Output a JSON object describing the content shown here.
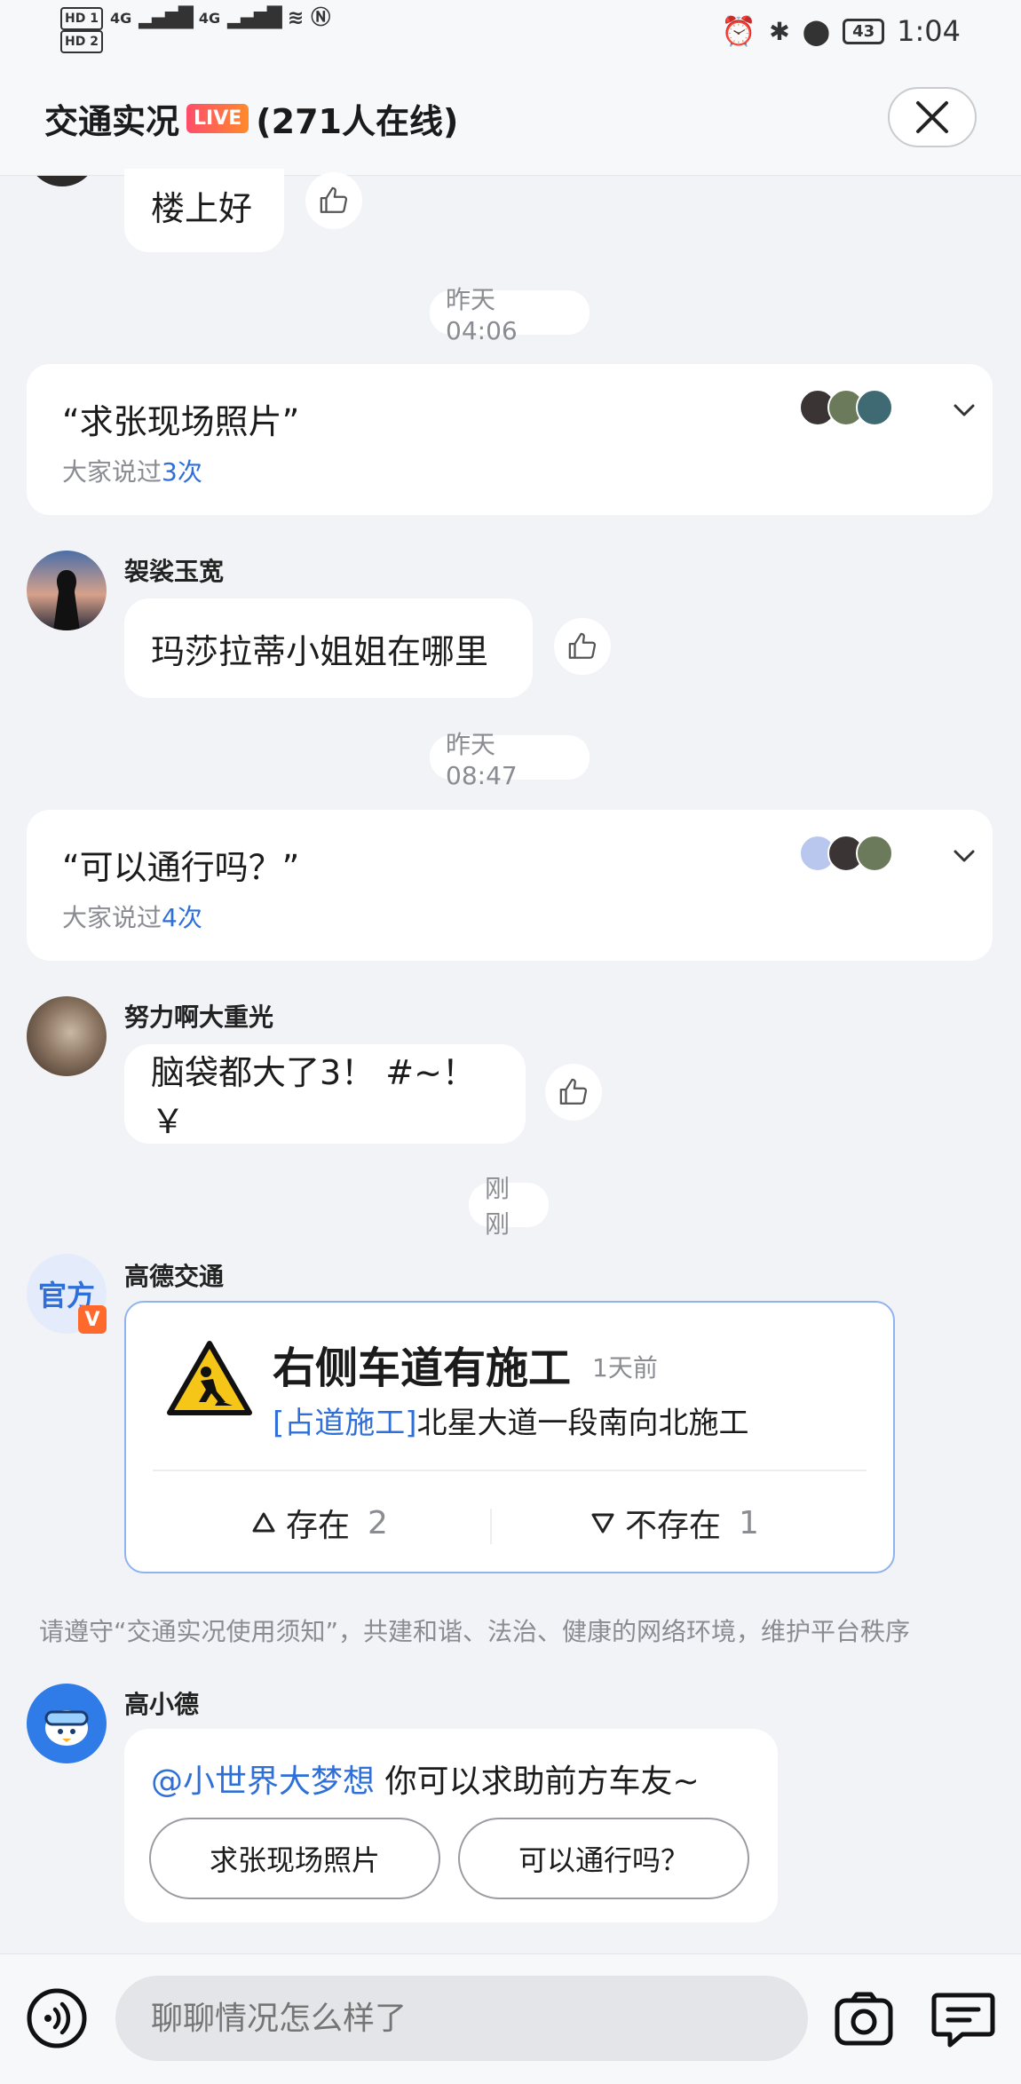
{
  "status_bar": {
    "hd1": "HD 1",
    "hd2": "HD 2",
    "net1": "4G",
    "net2": "4G",
    "battery": "43",
    "time": "1:04"
  },
  "header": {
    "title": "交通实况",
    "live_badge": "LIVE",
    "online": "(271人在线)"
  },
  "messages": {
    "top_bubble": "楼上好",
    "time1": "昨天 04:06",
    "card1": {
      "quote": "“求张现场照片”",
      "sub_prefix": "大家说过",
      "count": "3次"
    },
    "msg1": {
      "user": "袈裟玉宽",
      "text": "玛莎拉蒂小姐姐在哪里"
    },
    "time2": "昨天 08:47",
    "card2": {
      "quote": "“可以通行吗？”",
      "sub_prefix": "大家说过",
      "count": "4次"
    },
    "msg2": {
      "user": "努力啊大重光",
      "text": "脑袋都大了3！ #~！ ￥"
    },
    "time3": "刚刚",
    "official": {
      "user": "高德交通",
      "badge": "官方",
      "v_badge": "V",
      "title": "右侧车道有施工",
      "ago": "1天前",
      "tag": "[占道施工]",
      "desc": "北星大道一段南向北施工",
      "exists_label": "存在",
      "exists_count": "2",
      "not_exists_label": "不存在",
      "not_exists_count": "1"
    },
    "notice": "请遵守“交通实况使用须知”，共建和谐、法治、健康的网络环境，维护平台秩序",
    "bot": {
      "user": "高小德",
      "mention": "@小世界大梦想",
      "text": " 你可以求助前方车友~",
      "btn1": "求张现场照片",
      "btn2": "可以通行吗？"
    }
  },
  "input": {
    "placeholder": "聊聊情况怎么样了"
  },
  "colors": {
    "accent": "#2f6fd9",
    "background": "#f2f3f7"
  }
}
